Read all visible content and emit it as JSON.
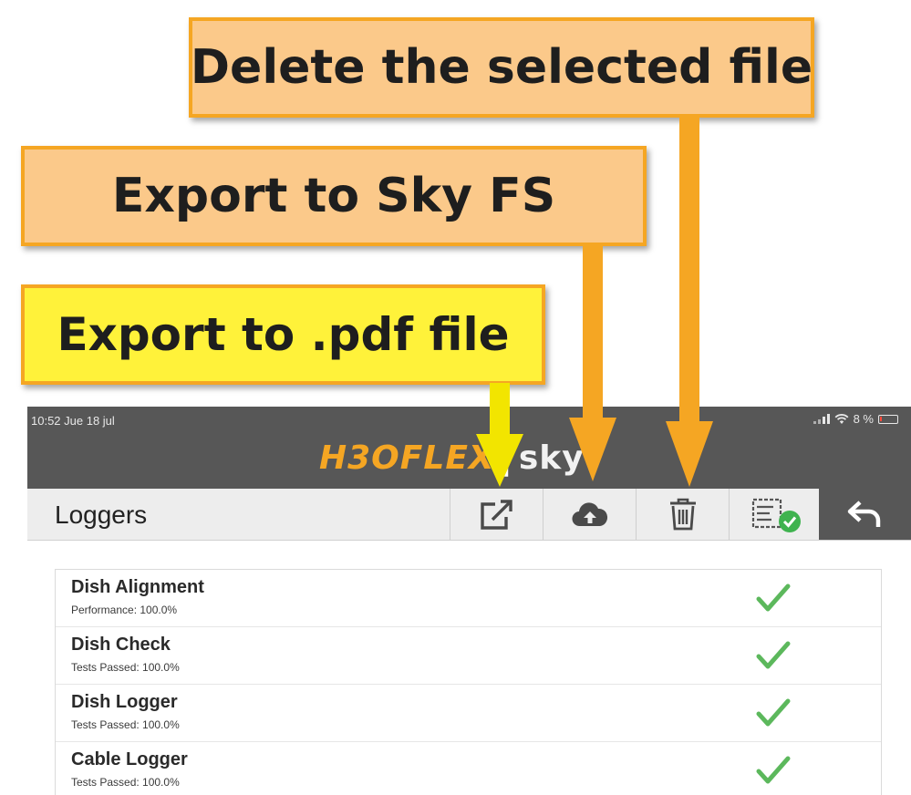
{
  "callouts": {
    "delete": "Delete the selected file",
    "sky": "Export to Sky FS",
    "pdf": "Export to .pdf file"
  },
  "status_bar": {
    "time": "10:52  Jue 18 jul",
    "battery": "8 %"
  },
  "logo": {
    "left": "H3OFLEX",
    "right": "sky"
  },
  "toolbar": {
    "title": "Loggers",
    "export_pdf_icon": "share-export-icon",
    "export_sky_icon": "cloud-upload-icon",
    "delete_icon": "trash-icon",
    "select_icon": "select-all-check-icon",
    "back_icon": "back-arrow-icon"
  },
  "loggers": [
    {
      "name": "Dish Alignment",
      "detail": "Performance: 100.0%",
      "status": "passed"
    },
    {
      "name": "Dish Check",
      "detail": "Tests Passed: 100.0%",
      "status": "passed"
    },
    {
      "name": "Dish Logger",
      "detail": "Tests Passed: 100.0%",
      "status": "passed"
    },
    {
      "name": "Cable Logger",
      "detail": "Tests Passed: 100.0%",
      "status": "passed"
    }
  ],
  "colors": {
    "callout_orange": "#fbc98a",
    "callout_yellow": "#fff23a",
    "arrow_orange": "#f5a623",
    "arrow_yellow": "#f2e500",
    "header_gray": "#575757",
    "check_green": "#5cb85c",
    "badge_green": "#3fb34f"
  }
}
